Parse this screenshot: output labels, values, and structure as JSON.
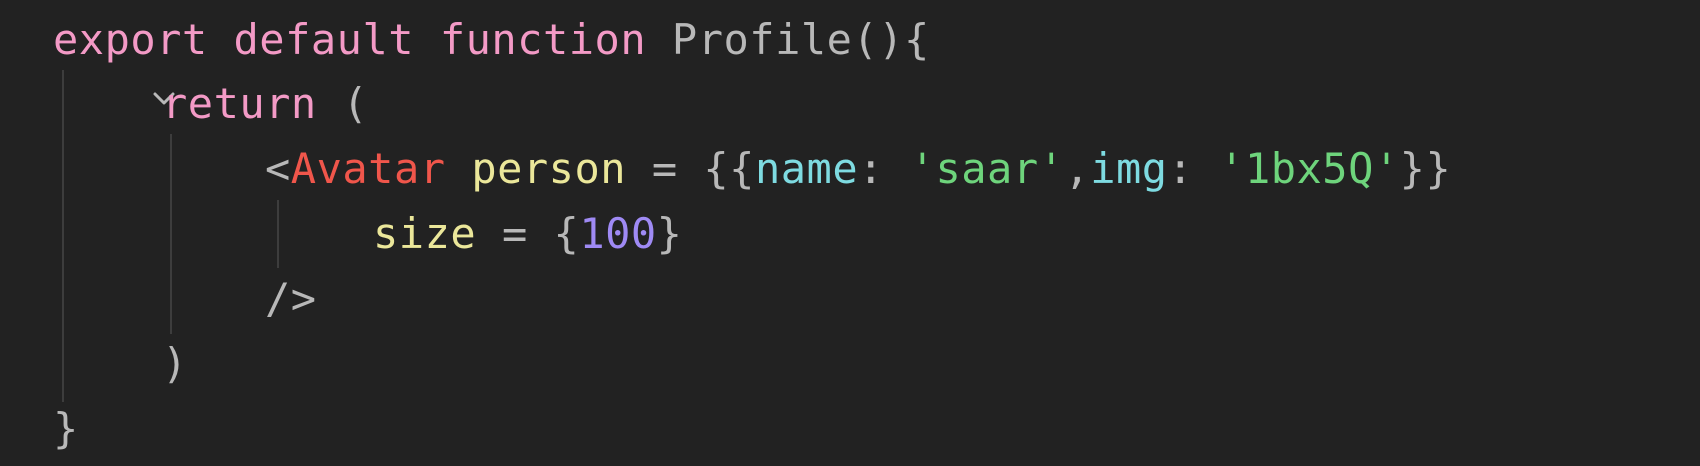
{
  "colors": {
    "background": "#222222",
    "keyword": "#f39ac6",
    "plain": "#b8b8b8",
    "tag": "#f0564b",
    "attribute": "#ebe79a",
    "property": "#7edbe1",
    "string": "#6ed47c",
    "number": "#9f8af4",
    "indent_guide": "#3d3d3d"
  },
  "icons": {
    "fold": "chevron-down-icon"
  },
  "code": {
    "line1": {
      "kw_export": "export",
      "kw_default": "default",
      "kw_function": "function",
      "fn_name": "Profile",
      "parens_brace": "(){"
    },
    "line2": {
      "kw_return": "return",
      "paren": "("
    },
    "line3": {
      "lt": "<",
      "tag": "Avatar",
      "attr": "person",
      "eq": " = ",
      "open": "{{",
      "key_name": "name",
      "colon1": ": ",
      "val_name": "'saar'",
      "comma": ",",
      "key_img": "img",
      "colon2": ": ",
      "val_img": "'1bx5Q'",
      "close": "}}"
    },
    "line4": {
      "attr": "size",
      "eq": " = ",
      "open": "{",
      "num": "100",
      "close": "}"
    },
    "line5": {
      "selfclose": "/>"
    },
    "line6": {
      "paren": ")"
    },
    "line7": {
      "brace": "}"
    }
  }
}
